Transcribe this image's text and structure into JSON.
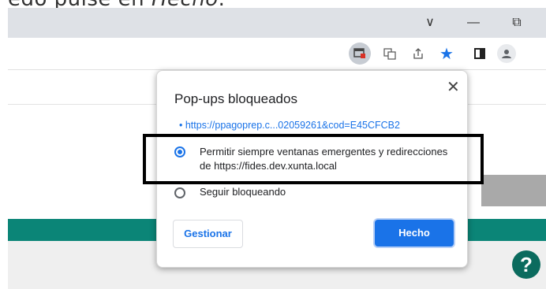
{
  "caption": {
    "text_start": "edo pulse en ",
    "text_em": "Hecho",
    "text_end": "."
  },
  "window": {
    "minimize": "—",
    "restore": "⧉",
    "dropdown": "∨"
  },
  "popup": {
    "title": "Pop-ups bloqueados",
    "link": "https://ppagoprep.c...02059261&cod=E45CFCB2",
    "option_allow": "Permitir siempre ventanas emergentes y redirecciones de https://fides.dev.xunta.local",
    "option_block": "Seguir bloqueando",
    "selected": "allow",
    "manage_button": "Gestionar",
    "done_button": "Hecho",
    "close": "✕"
  },
  "help": {
    "label": "?"
  },
  "colors": {
    "accent": "#1a73e8",
    "teal": "#0b8577",
    "toolbar_bg": "#dee1e6"
  },
  "icons": [
    "popup-blocked-icon",
    "translate-icon",
    "share-icon",
    "star-icon",
    "sidepanel-icon",
    "profile-icon"
  ]
}
